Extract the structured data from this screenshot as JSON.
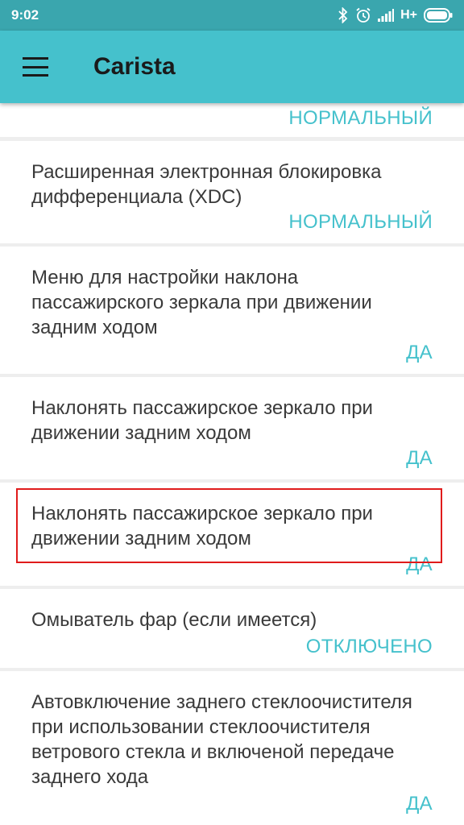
{
  "status_bar": {
    "time": "9:02",
    "network": "H+",
    "icons": [
      "bluetooth-icon",
      "alarm-icon",
      "signal-icon",
      "battery-icon"
    ],
    "color": "#3aa6ae"
  },
  "app_bar": {
    "title": "Carista",
    "menu_icon": "hamburger-menu-icon",
    "color": "#45c1cc"
  },
  "accent_color": "#45c1cc",
  "highlight_color": "#e01b1b",
  "settings": [
    {
      "title": "",
      "value": "НОРМАЛЬНЫЙ"
    },
    {
      "title": "Расширенная электронная блокировка дифференциала (XDC)",
      "value": "НОРМАЛЬНЫЙ"
    },
    {
      "title": "Меню для настройки наклона пассажирского зеркала при движении задним ходом",
      "value": "ДА"
    },
    {
      "title": "Наклонять пассажирское зеркало при движении задним ходом",
      "value": "ДА"
    },
    {
      "title": "Наклонять пассажирское зеркало при движении задним ходом",
      "value": "ДА"
    },
    {
      "title": "Омыватель фар (если имеется)",
      "value": "ОТКЛЮЧЕНО",
      "highlighted": true
    },
    {
      "title": "Автовключение заднего стеклоочистителя при использовании стеклоочистителя ветрового стекла и включеной передаче заднего хода",
      "value": "ДА"
    }
  ]
}
